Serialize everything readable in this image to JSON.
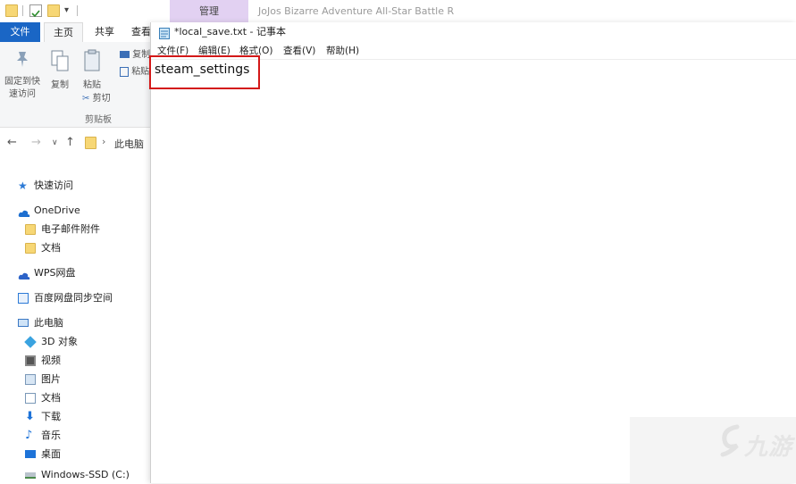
{
  "explorer": {
    "contextual_tab": "管理",
    "app_title": "JoJos Bizarre Adventure All-Star Battle R",
    "ribbon_tabs": {
      "file": "文件",
      "home": "主页",
      "share": "共享",
      "view": "查看"
    },
    "ribbon": {
      "pin_label": "固定到快速访问",
      "copy_label": "复制",
      "paste_label": "粘贴",
      "copy_path_label": "复制",
      "paste_shortcut_label": "粘贴",
      "cut_label": "剪切",
      "clipboard_group": "剪贴板"
    },
    "address": {
      "current": "此电脑"
    },
    "nav": {
      "quick_access": "快速访问",
      "onedrive": "OneDrive",
      "email_attachments": "电子邮件附件",
      "documents_onedrive": "文档",
      "wps": "WPS网盘",
      "baidu": "百度网盘同步空间",
      "this_pc": "此电脑",
      "objects_3d": "3D 对象",
      "videos": "视频",
      "pictures": "图片",
      "documents": "文档",
      "downloads": "下载",
      "music": "音乐",
      "desktop": "桌面",
      "drive_c": "Windows-SSD (C:)"
    }
  },
  "notepad": {
    "title": "*local_save.txt - 记事本",
    "menu": {
      "file": "文件(F)",
      "edit": "编辑(E)",
      "format": "格式(O)",
      "view": "查看(V)",
      "help": "帮助(H)"
    },
    "content": "steam_settings"
  },
  "watermark": {
    "text": "九游"
  },
  "colors": {
    "file_tab": "#1a66c5",
    "contextual_tab": "#e2d1f2",
    "highlight": "#d31818"
  }
}
